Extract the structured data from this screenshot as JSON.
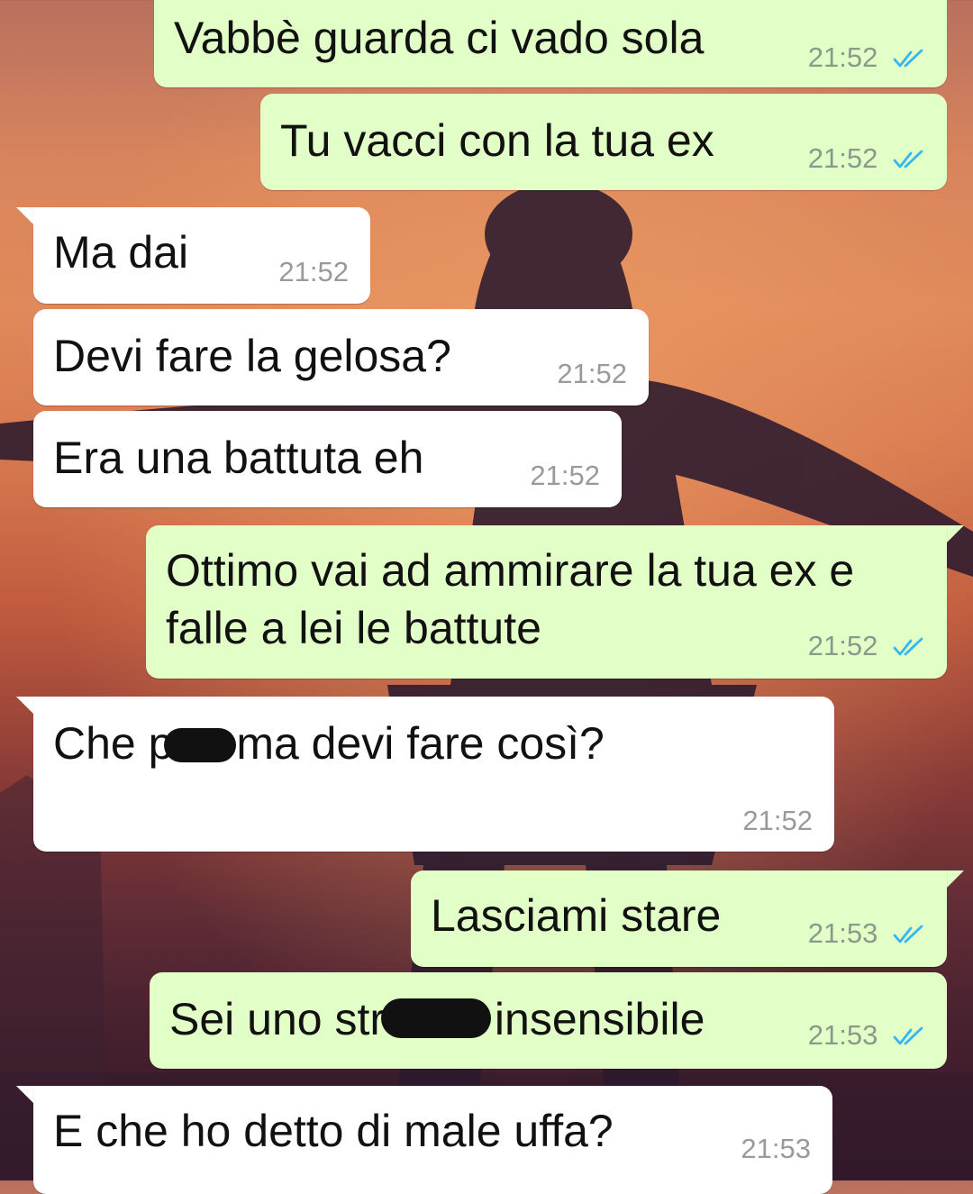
{
  "conversation": {
    "messages": [
      {
        "direction": "out",
        "text": "Vabbè guarda ci vado sola",
        "time": "21:52",
        "status": "read"
      },
      {
        "direction": "out",
        "text": "Tu vacci con la tua ex",
        "time": "21:52",
        "status": "read"
      },
      {
        "direction": "in",
        "text": "Ma dai",
        "time": "21:52"
      },
      {
        "direction": "in",
        "text": "Devi fare la gelosa?",
        "time": "21:52"
      },
      {
        "direction": "in",
        "text": "Era una battuta eh",
        "time": "21:52"
      },
      {
        "direction": "out",
        "text_line1": "Ottimo vai ad ammirare la tua ex e",
        "text_line2": "falle a lei le battute",
        "time": "21:52",
        "status": "read"
      },
      {
        "direction": "in",
        "text_before": "Che p",
        "text_after": " ma devi fare così?",
        "time": "21:52",
        "redacted": true
      },
      {
        "direction": "out",
        "text": "Lasciami stare",
        "time": "21:53",
        "status": "read"
      },
      {
        "direction": "out",
        "text_before": "Sei uno str",
        "text_after": " insensibile",
        "time": "21:53",
        "status": "read",
        "redacted": true
      },
      {
        "direction": "in",
        "text": "E che ho detto di male uffa?",
        "time": "21:53"
      }
    ]
  },
  "colors": {
    "outgoing_bubble": "#e2ffc7",
    "incoming_bubble": "#ffffff",
    "read_ticks": "#34b7f1",
    "timestamp": "#8a9a8a"
  },
  "icons": {
    "read_receipt": "double-check-icon"
  }
}
